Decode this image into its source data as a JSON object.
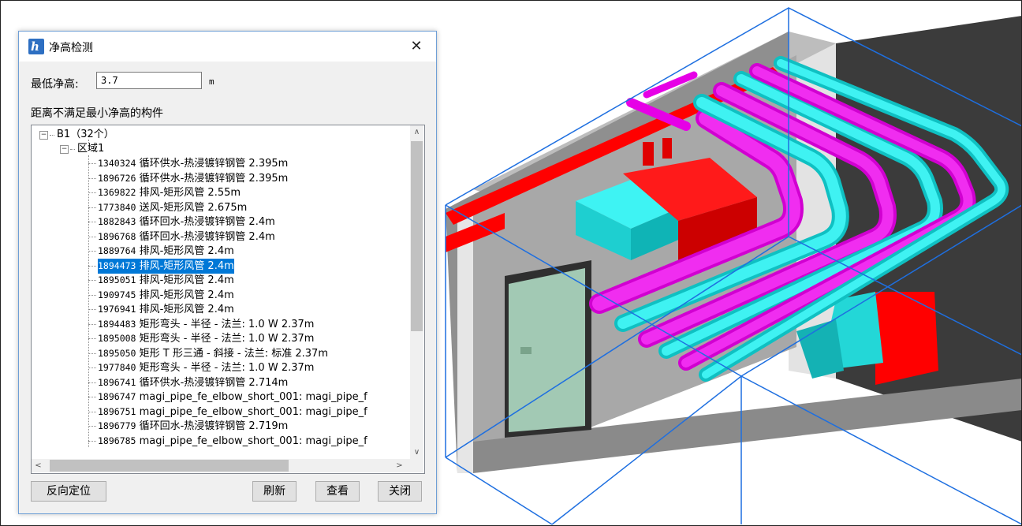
{
  "dialog": {
    "title": "净高检测",
    "min_height_label": "最低净高:",
    "min_height_value": "3.7",
    "min_height_unit": "m",
    "list_label": "距离不满足最小净高的构件",
    "tree": {
      "root": {
        "label": "B1（32个）",
        "expanded": true
      },
      "region": {
        "label": "区域1",
        "expanded": true
      },
      "items": [
        {
          "id": "1340324",
          "text": "循环供水-热浸镀锌钢管 2.395m",
          "selected": false
        },
        {
          "id": "1896726",
          "text": "循环供水-热浸镀锌钢管 2.395m",
          "selected": false
        },
        {
          "id": "1369822",
          "text": "排风-矩形风管 2.55m",
          "selected": false
        },
        {
          "id": "1773840",
          "text": "送风-矩形风管 2.675m",
          "selected": false
        },
        {
          "id": "1882843",
          "text": "循环回水-热浸镀锌钢管 2.4m",
          "selected": false
        },
        {
          "id": "1896768",
          "text": "循环回水-热浸镀锌钢管 2.4m",
          "selected": false
        },
        {
          "id": "1889764",
          "text": "排风-矩形风管 2.4m",
          "selected": false
        },
        {
          "id": "1894473",
          "text": "排风-矩形风管 2.4m",
          "selected": true
        },
        {
          "id": "1895051",
          "text": "排风-矩形风管 2.4m",
          "selected": false
        },
        {
          "id": "1909745",
          "text": "排风-矩形风管 2.4m",
          "selected": false
        },
        {
          "id": "1976941",
          "text": "排风-矩形风管 2.4m",
          "selected": false
        },
        {
          "id": "1894483",
          "text": "矩形弯头 - 半径 - 法兰: 1.0 W 2.37m",
          "selected": false
        },
        {
          "id": "1895008",
          "text": "矩形弯头 - 半径 - 法兰: 1.0 W 2.37m",
          "selected": false
        },
        {
          "id": "1895050",
          "text": "矩形 T 形三通 - 斜接 - 法兰: 标准 2.37m",
          "selected": false
        },
        {
          "id": "1977840",
          "text": "矩形弯头 - 半径 - 法兰: 1.0 W 2.37m",
          "selected": false
        },
        {
          "id": "1896741",
          "text": "循环供水-热浸镀锌钢管 2.714m",
          "selected": false
        },
        {
          "id": "1896747",
          "text": "magi_pipe_fe_elbow_short_001: magi_pipe_f",
          "selected": false
        },
        {
          "id": "1896751",
          "text": "magi_pipe_fe_elbow_short_001: magi_pipe_f",
          "selected": false
        },
        {
          "id": "1896779",
          "text": "循环回水-热浸镀锌钢管 2.719m",
          "selected": false
        },
        {
          "id": "1896785",
          "text": "magi_pipe_fe_elbow_short_001: magi_pipe_f",
          "selected": false
        }
      ]
    },
    "buttons": {
      "reverse_locate": "反向定位",
      "refresh": "刷新",
      "view": "查看",
      "close": "关闭"
    },
    "close_glyph": "✕",
    "scroll_up": "∧",
    "scroll_down": "∨",
    "scroll_left": "<",
    "scroll_right": ">"
  },
  "viewport": {
    "colors": {
      "wall_light": "#e0e0e0",
      "wall_mid": "#b4b4b4",
      "wall_dark": "#3a3a3a",
      "red": "#ff0000",
      "cyan": "#00d8dc",
      "magenta": "#e600e6",
      "door": "#9ec6b0",
      "bbox": "#1e6fe0"
    }
  }
}
